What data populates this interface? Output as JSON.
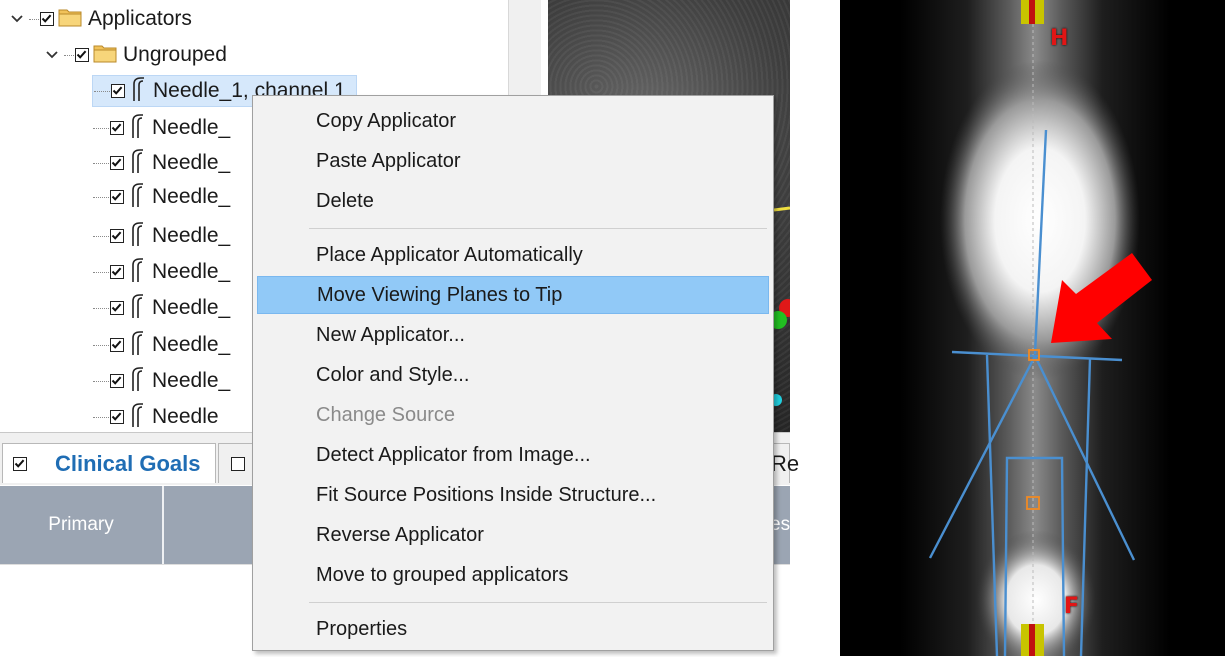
{
  "tree": {
    "items": [
      {
        "label": "Applicators",
        "level": 0,
        "checked": true,
        "icon": "folder-icon"
      },
      {
        "label": "Ungrouped",
        "level": 1,
        "checked": true,
        "icon": "folder-icon"
      },
      {
        "label": "Needle_1, channel 1",
        "level": 2,
        "checked": true,
        "icon": "needle-icon",
        "selected": true
      },
      {
        "label": "Needle_",
        "level": 2,
        "checked": true,
        "icon": "needle-icon"
      },
      {
        "label": "Needle_",
        "level": 2,
        "checked": true,
        "icon": "needle-icon"
      },
      {
        "label": "Needle_",
        "level": 2,
        "checked": true,
        "icon": "needle-icon"
      },
      {
        "label": "Needle_",
        "level": 2,
        "checked": true,
        "icon": "needle-icon"
      },
      {
        "label": "Needle_",
        "level": 2,
        "checked": true,
        "icon": "needle-icon"
      },
      {
        "label": "Needle_",
        "level": 2,
        "checked": true,
        "icon": "needle-icon"
      },
      {
        "label": "Needle_",
        "level": 2,
        "checked": true,
        "icon": "needle-icon"
      },
      {
        "label": "Needle_",
        "level": 2,
        "checked": true,
        "icon": "needle-icon"
      },
      {
        "label": "Needle",
        "level": 2,
        "checked": true,
        "icon": "needle-icon"
      }
    ]
  },
  "tabs": {
    "clinical_goals": {
      "label": "Clinical Goals",
      "checked": true
    },
    "second_tab": {
      "checked": false
    },
    "right_fragment": "Re"
  },
  "table": {
    "headers": {
      "primary": "Primary",
      "second": "",
      "right_fragment": "es"
    }
  },
  "context_menu": {
    "items": [
      {
        "label": "Copy Applicator"
      },
      {
        "label": "Paste Applicator"
      },
      {
        "label": "Delete"
      },
      {
        "separator": true
      },
      {
        "label": "Place Applicator Automatically"
      },
      {
        "label": "Move Viewing Planes to Tip",
        "highlighted": true
      },
      {
        "label": "New Applicator..."
      },
      {
        "label": "Color and Style..."
      },
      {
        "label": "Change Source",
        "disabled": true
      },
      {
        "label": "Detect Applicator from Image..."
      },
      {
        "label": "Fit Source Positions Inside Structure..."
      },
      {
        "label": "Reverse Applicator"
      },
      {
        "label": "Move to grouped applicators"
      },
      {
        "separator": true
      },
      {
        "label": "Properties"
      }
    ]
  },
  "viewer": {
    "top_marker": "H",
    "bottom_marker": "F",
    "colors": {
      "outline": "#4a8fd0",
      "accent_marker": "#f08a24",
      "arrow": "#ff0000",
      "marker_label": "#e21515",
      "yellow_marker": "#c8c400"
    }
  }
}
